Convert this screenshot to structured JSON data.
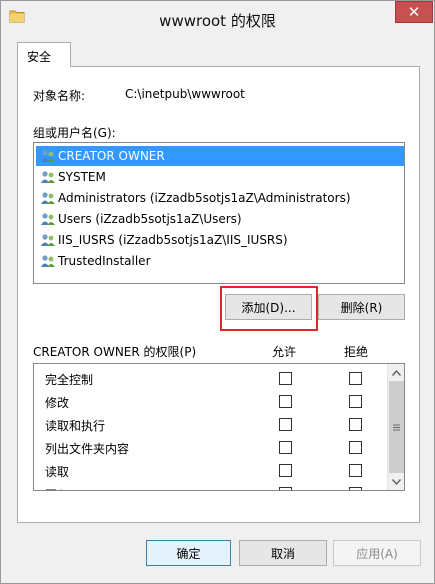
{
  "window": {
    "title": "wwwroot 的权限",
    "close_glyph": "✕"
  },
  "tabs": [
    {
      "label": "安全",
      "active": true
    }
  ],
  "object": {
    "label": "对象名称:",
    "value": "C:\\inetpub\\wwwroot"
  },
  "groups": {
    "label": "组或用户名(G):",
    "items": [
      {
        "name": "CREATOR OWNER",
        "selected": true,
        "icon": "user-group-icon"
      },
      {
        "name": "SYSTEM",
        "selected": false,
        "icon": "user-group-icon"
      },
      {
        "name": "Administrators (iZzadb5sotjs1aZ\\Administrators)",
        "selected": false,
        "icon": "user-group-icon"
      },
      {
        "name": "Users (iZzadb5sotjs1aZ\\Users)",
        "selected": false,
        "icon": "user-group-icon"
      },
      {
        "name": "IIS_IUSRS (iZzadb5sotjs1aZ\\IIS_IUSRS)",
        "selected": false,
        "icon": "user-group-icon"
      },
      {
        "name": "TrustedInstaller",
        "selected": false,
        "icon": "user-group-icon"
      }
    ],
    "add_button": "添加(D)...",
    "remove_button": "删除(R)"
  },
  "permissions": {
    "label": "CREATOR OWNER 的权限(P)",
    "allow_header": "允许",
    "deny_header": "拒绝",
    "rows": [
      {
        "name": "完全控制",
        "allow": false,
        "deny": false
      },
      {
        "name": "修改",
        "allow": false,
        "deny": false
      },
      {
        "name": "读取和执行",
        "allow": false,
        "deny": false
      },
      {
        "name": "列出文件夹内容",
        "allow": false,
        "deny": false
      },
      {
        "name": "读取",
        "allow": false,
        "deny": false
      },
      {
        "name": "写入",
        "allow": false,
        "deny": false
      }
    ]
  },
  "footer": {
    "ok": "确定",
    "cancel": "取消",
    "apply": "应用(A)"
  },
  "colors": {
    "selection": "#3399ff",
    "highlight_box": "#e3262d",
    "close_button": "#c75050"
  }
}
